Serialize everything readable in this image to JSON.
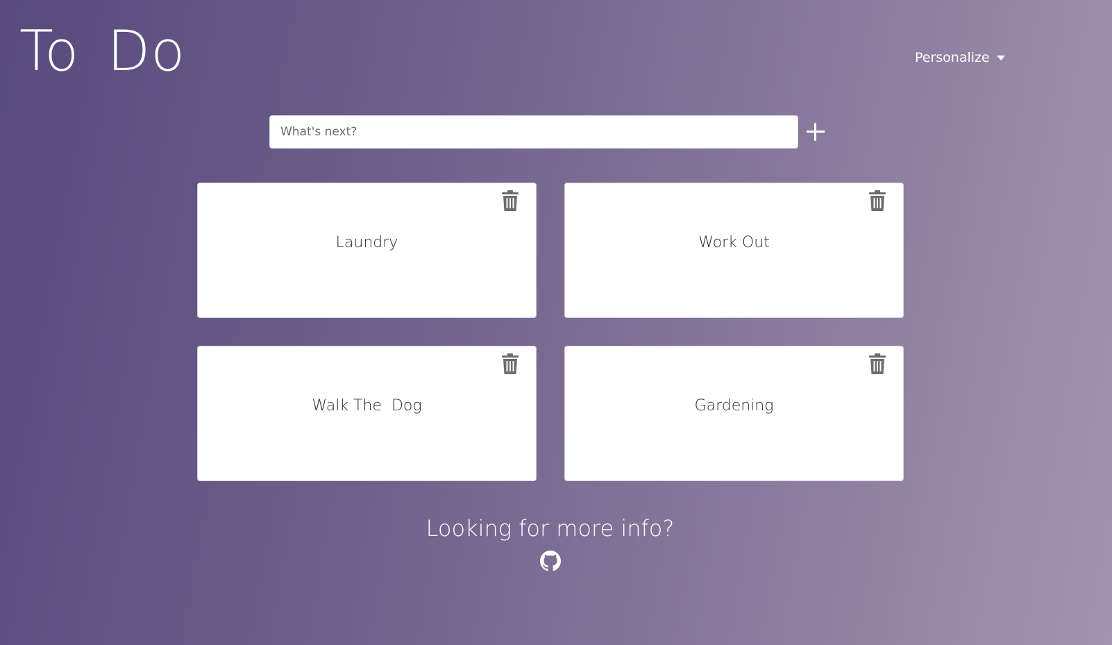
{
  "header": {
    "title": "To Do",
    "menu_label": "Personalize"
  },
  "entry": {
    "placeholder": "What's next?",
    "value": ""
  },
  "tasks": [
    {
      "label": "Laundry"
    },
    {
      "label": "Work Out"
    },
    {
      "label": "Walk The  Dog"
    },
    {
      "label": "Gardening"
    }
  ],
  "icons": {
    "add": "plus-icon",
    "delete": "trash-icon",
    "menu": "chevron-down-icon",
    "repo": "github-icon"
  },
  "footer": {
    "text": "Looking for more info?"
  },
  "colors": {
    "gradient_start": "#574a7c",
    "gradient_end": "#a394ad",
    "card_background": "#ffffff",
    "icon_gray": "#6d6d6d"
  }
}
